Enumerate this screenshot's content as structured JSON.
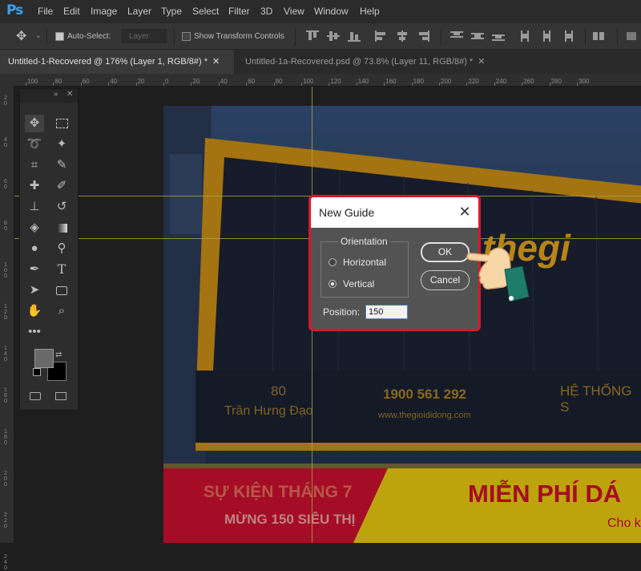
{
  "app": {
    "logo": "Ps"
  },
  "menu": [
    "File",
    "Edit",
    "Image",
    "Layer",
    "Type",
    "Select",
    "Filter",
    "3D",
    "View",
    "Window",
    "Help"
  ],
  "options": {
    "auto_select_label": "Auto-Select:",
    "auto_select_value": "Layer",
    "transform_label": "Show Transform Controls"
  },
  "tabs": [
    {
      "label": "Untitled-1-Recovered @ 176% (Layer 1, RGB/8#) *"
    },
    {
      "label": "Untitled-1a-Recovered.psd @ 73.8% (Layer 11, RGB/8#) *"
    }
  ],
  "ruler": {
    "h_ticks": [
      "100",
      "80",
      "60",
      "40",
      "20",
      "0",
      "20",
      "40",
      "60",
      "80",
      "100",
      "120",
      "140",
      "160",
      "180",
      "200",
      "220",
      "240",
      "260",
      "280",
      "300"
    ],
    "v_ticks": [
      "2 0",
      "4 0",
      "6 0",
      "8 0",
      "1 0 0",
      "1 2 0",
      "1 4 0",
      "1 6 0",
      "1 8 0",
      "2 0 0",
      "2 2 0",
      "2 4 0"
    ]
  },
  "photo": {
    "sign_brand": "thegi",
    "sign_address_number": "80",
    "sign_address_street": "Trần Hưng Đạo",
    "sign_phone": "1900 561 292",
    "sign_website": "www.thegioididong.com",
    "sign_system": "HỆ THỐNG S",
    "banner_left_1": "SỰ KIỆN THÁNG 7",
    "banner_left_2": "MỪNG 150 SIÊU THỊ",
    "banner_right_1": "MIỄN PHÍ DÁ",
    "banner_right_2": "Cho k"
  },
  "dialog": {
    "title": "New Guide",
    "orientation_label": "Orientation",
    "horizontal_label": "Horizontal",
    "vertical_label": "Vertical",
    "selected_orientation": "Vertical",
    "ok_label": "OK",
    "cancel_label": "Cancel",
    "position_label": "Position:",
    "position_value": "150"
  },
  "colors": {
    "accent_red": "#d9172b",
    "ps_blue": "#3aa0e8",
    "guide": "#a9a44a",
    "sign_yellow": "#e0a21a"
  }
}
